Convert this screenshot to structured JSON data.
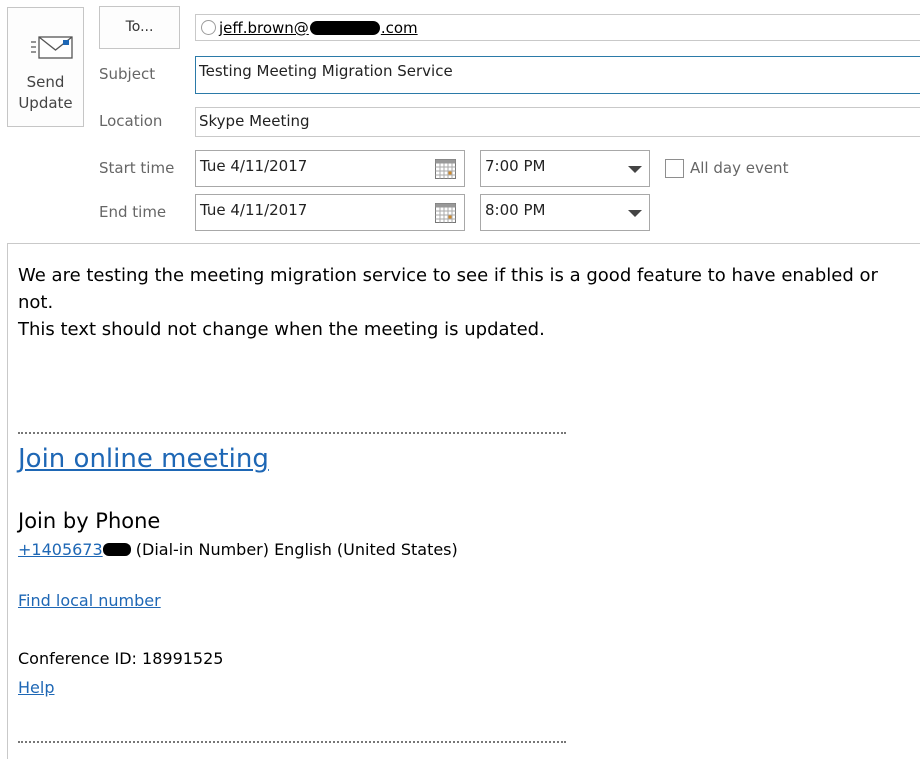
{
  "toolbar": {
    "send_update_label_line1": "Send",
    "send_update_label_line2": "Update",
    "to_button_label": "To..."
  },
  "fields": {
    "to_value_prefix": "jeff.brown@",
    "to_value_suffix": ".com",
    "subject_label": "Subject",
    "subject_value": "Testing Meeting Migration Service",
    "location_label": "Location",
    "location_value": "Skype Meeting",
    "start_time_label": "Start time",
    "start_date_value": "Tue 4/11/2017",
    "start_time_value": "7:00 PM",
    "end_time_label": "End time",
    "end_date_value": "Tue 4/11/2017",
    "end_time_value": "8:00 PM",
    "all_day_label": "All day event",
    "all_day_checked": false
  },
  "body": {
    "line1": "We are testing the meeting migration service to see if this is a good feature to have enabled or not.",
    "line2": "This text should not change when the meeting is updated.",
    "join_online_label": "Join online meeting",
    "join_by_phone_heading": "Join by Phone",
    "phone_number_prefix": "+1405673",
    "phone_description": "(Dial-in Number) English (United States)",
    "find_local_number_label": "Find local number",
    "conference_id_text": "Conference ID: 18991525",
    "help_label": "Help"
  },
  "colors": {
    "link": "#1e67b5",
    "subject_focus_border": "#2b7aa8"
  }
}
